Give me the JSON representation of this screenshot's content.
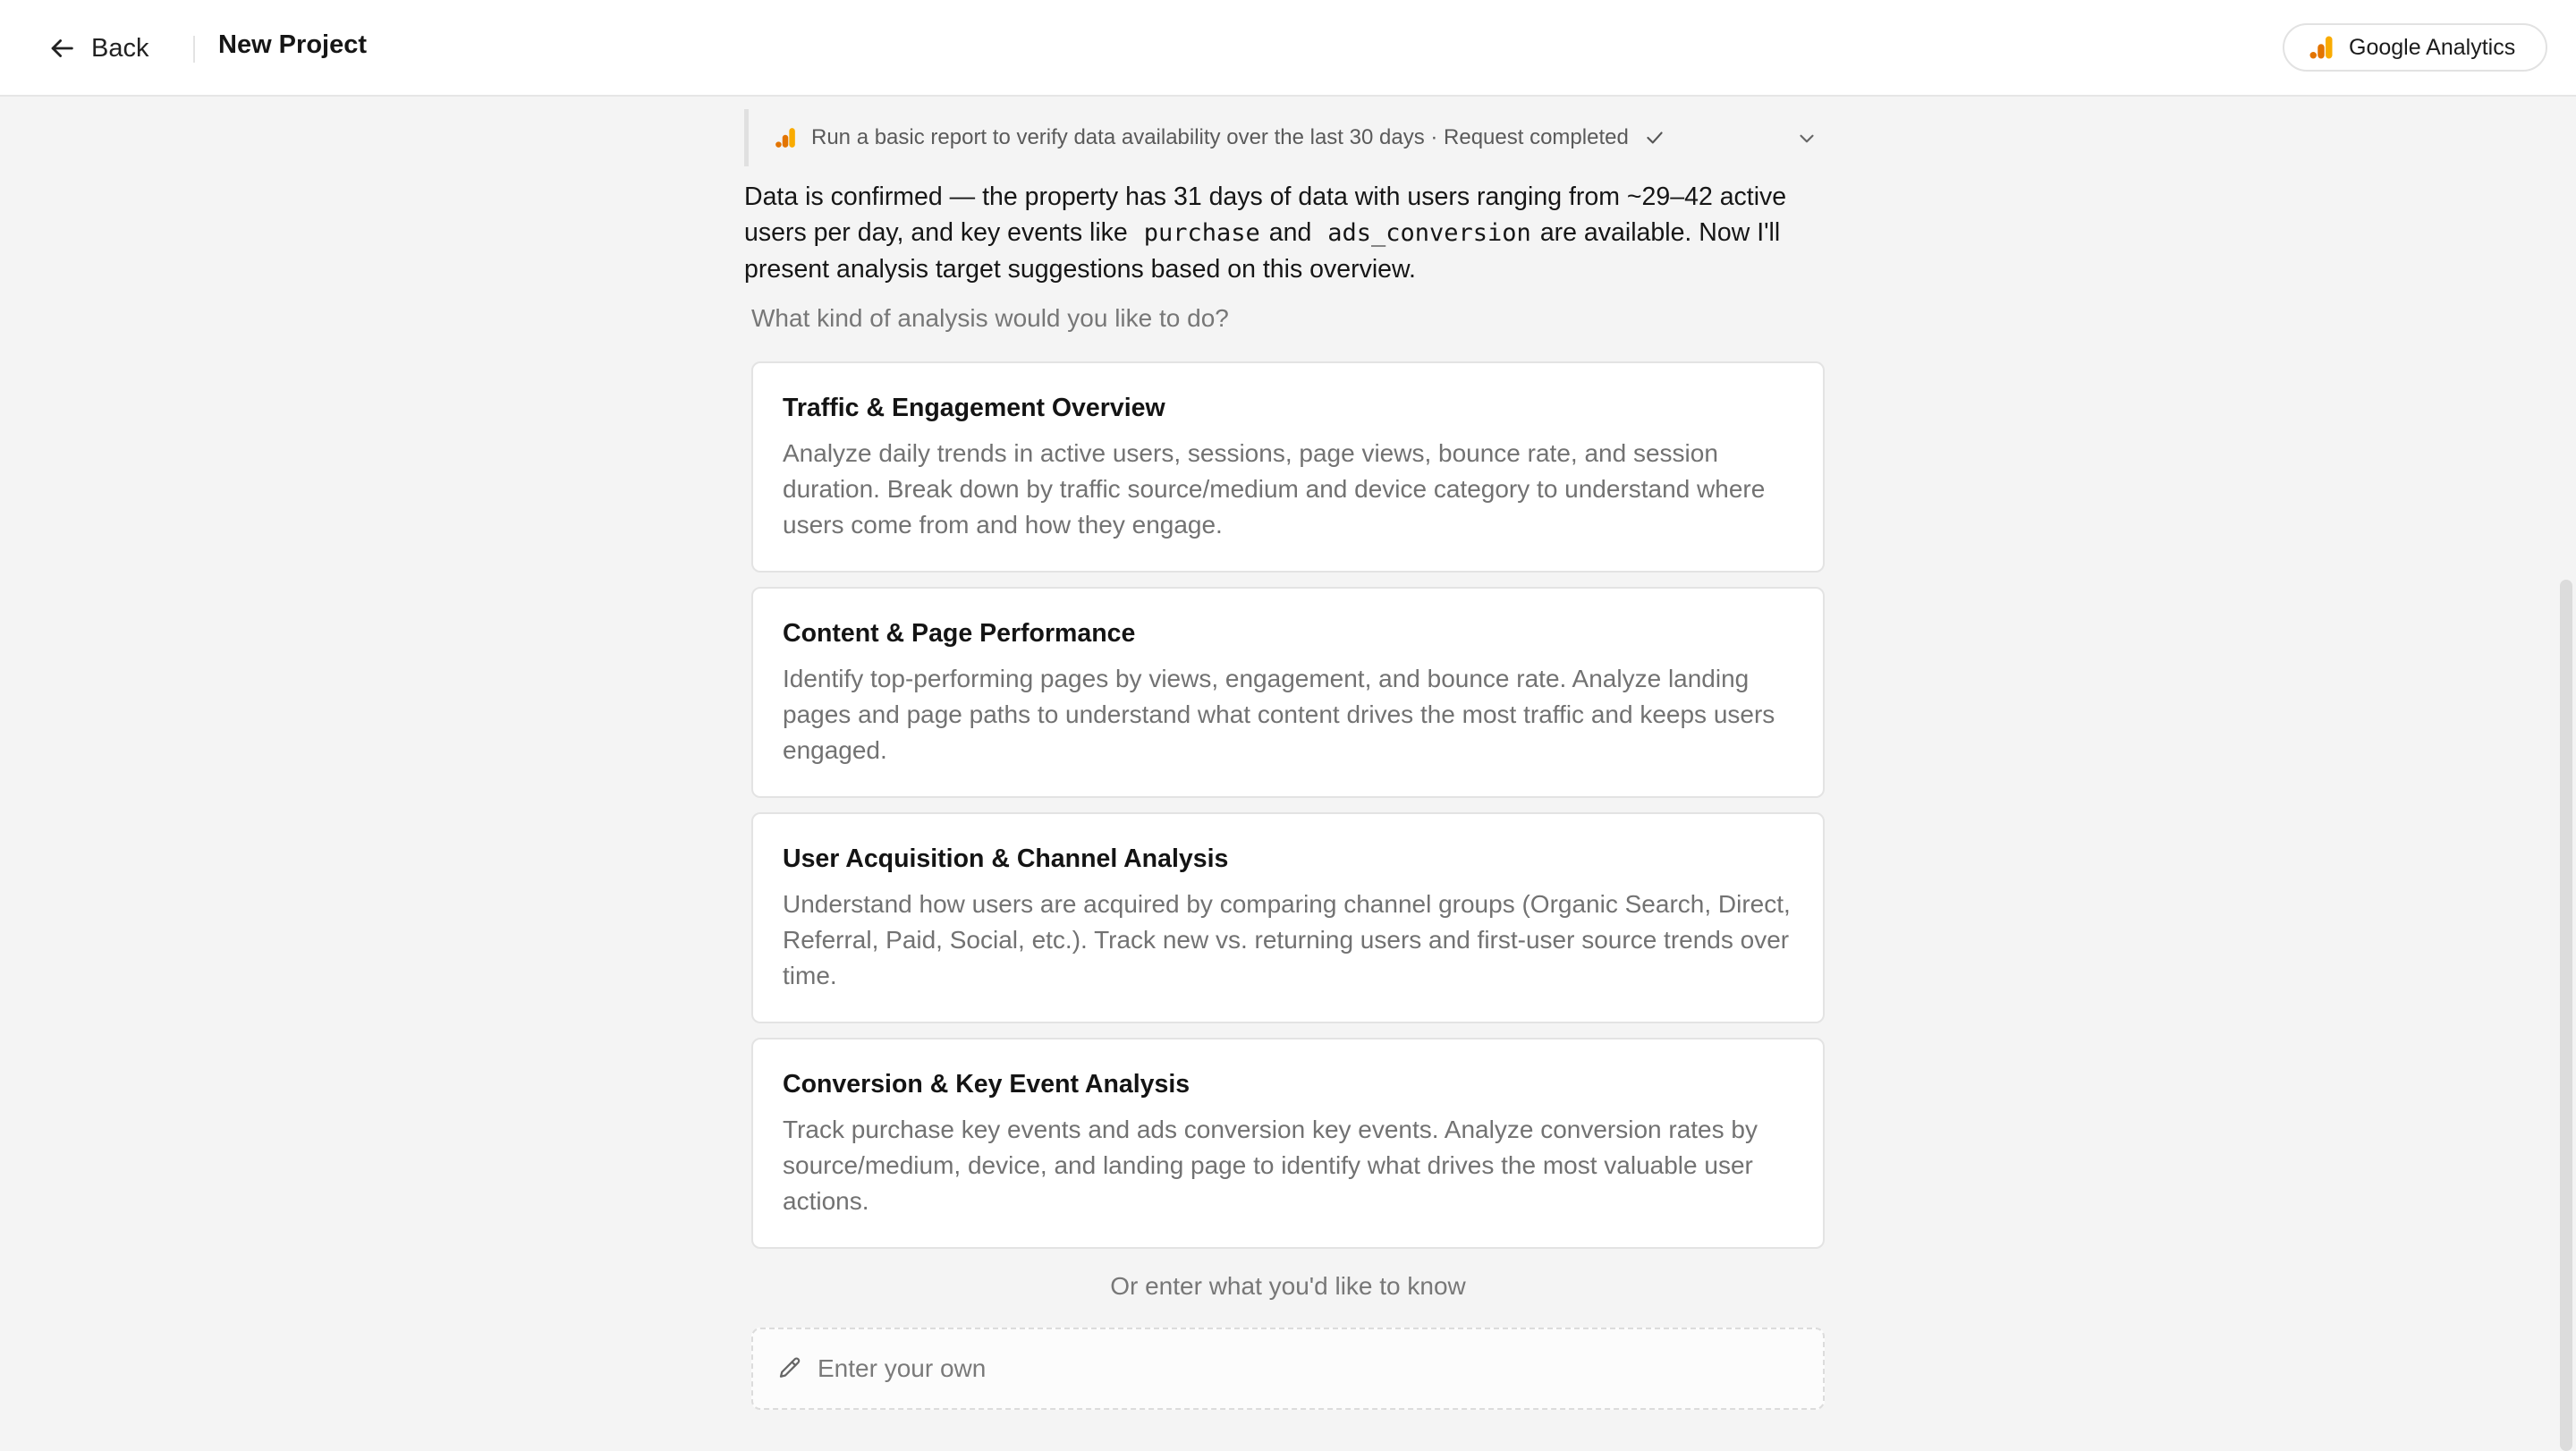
{
  "header": {
    "back_label": "Back",
    "project_title": "New Project",
    "integration_label": "Google Analytics",
    "integration_icon": "google-analytics-icon",
    "integration_colors": [
      "#F9AB00",
      "#E37400"
    ]
  },
  "tool_call": {
    "text": "Run a basic report to verify data availability over the last 30 days · Request completed",
    "status_icon": "check-icon",
    "expand_icon": "chevron-down-icon"
  },
  "summary": {
    "part1": "Data is confirmed — the property has 31 days of data with users ranging from ~29–42 active users per day, and key events like",
    "code1": "purchase",
    "part2": "and",
    "code2": "ads_conversion",
    "part3": "are available. Now I'll present analysis target suggestions based on this overview."
  },
  "question": "What kind of analysis would you like to do?",
  "options": [
    {
      "title": "Traffic & Engagement Overview",
      "description": "Analyze daily trends in active users, sessions, page views, bounce rate, and session duration. Break down by traffic source/medium and device category to understand where users come from and how they engage."
    },
    {
      "title": "Content & Page Performance",
      "description": "Identify top-performing pages by views, engagement, and bounce rate. Analyze landing pages and page paths to understand what content drives the most traffic and keeps users engaged."
    },
    {
      "title": "User Acquisition & Channel Analysis",
      "description": "Understand how users are acquired by comparing channel groups (Organic Search, Direct, Referral, Paid, Social, etc.). Track new vs. returning users and first-user source trends over time."
    },
    {
      "title": "Conversion & Key Event Analysis",
      "description": "Track purchase key events and ads conversion key events. Analyze conversion rates by source/medium, device, and landing page to identify what drives the most valuable user actions."
    }
  ],
  "custom": {
    "or_label": "Or enter what you'd like to know",
    "placeholder": "Enter your own",
    "value": ""
  }
}
